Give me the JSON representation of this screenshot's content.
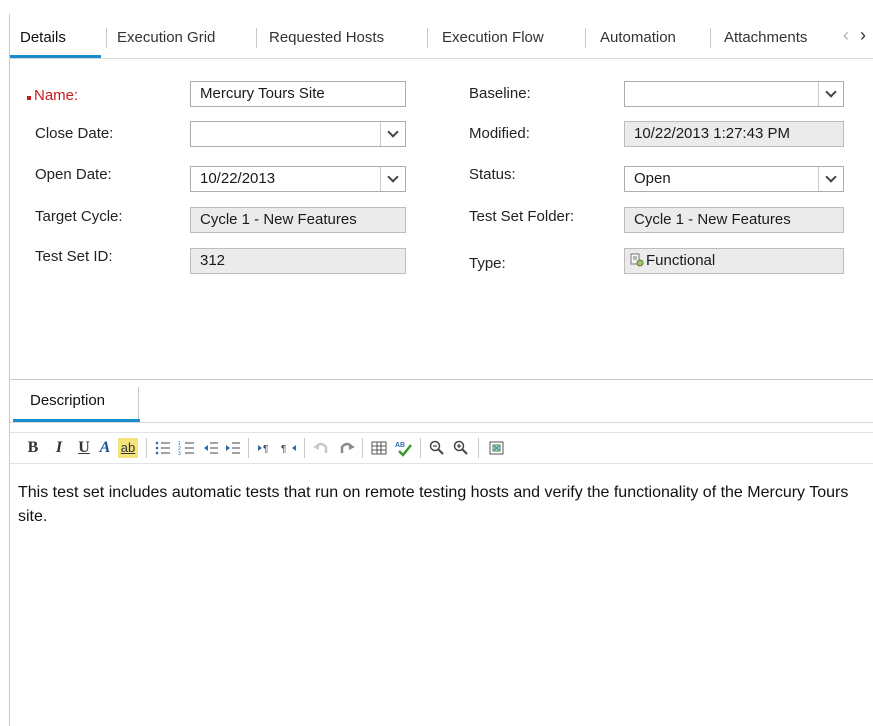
{
  "tabs": [
    {
      "label": "Details"
    },
    {
      "label": "Execution Grid"
    },
    {
      "label": "Requested Hosts"
    },
    {
      "label": "Execution Flow"
    },
    {
      "label": "Automation"
    },
    {
      "label": "Attachments"
    }
  ],
  "form": {
    "name": {
      "label": "Name:",
      "value": "Mercury Tours Site"
    },
    "baseline": {
      "label": "Baseline:",
      "value": ""
    },
    "close_date": {
      "label": "Close Date:",
      "value": ""
    },
    "modified": {
      "label": "Modified:",
      "value": "10/22/2013 1:27:43 PM"
    },
    "open_date": {
      "label": "Open Date:",
      "value": "10/22/2013"
    },
    "status": {
      "label": "Status:",
      "value": "Open"
    },
    "target_cycle": {
      "label": "Target Cycle:",
      "value": "Cycle 1 - New Features"
    },
    "test_set_folder": {
      "label": "Test Set Folder:",
      "value": "Cycle 1 - New Features"
    },
    "test_set_id": {
      "label": "Test Set ID:",
      "value": "312"
    },
    "type": {
      "label": "Type:",
      "value": "Functional"
    }
  },
  "description": {
    "tab_label": "Description",
    "text": "This test set includes automatic tests that run on remote testing hosts and verify the functionality of the Mercury Tours site."
  },
  "toolbar": {
    "bold": "B",
    "italic": "I",
    "underline": "U",
    "font_color": "A",
    "highlight": "ab"
  },
  "colors": {
    "accent": "#1a8ccc",
    "required": "#c41d1d"
  }
}
